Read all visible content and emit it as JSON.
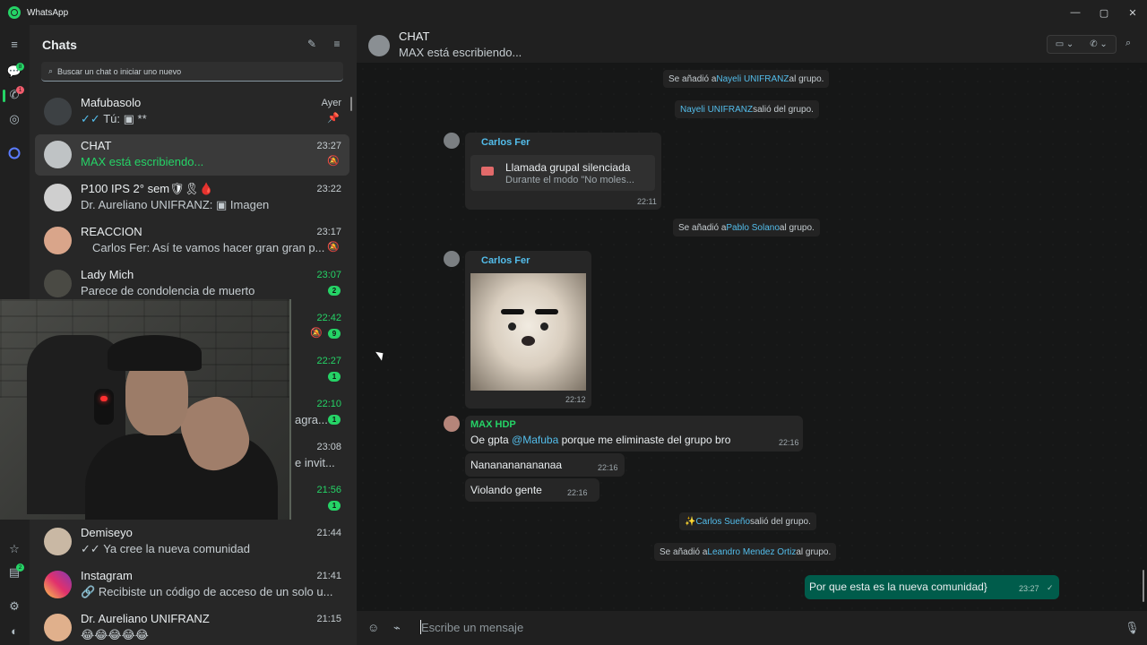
{
  "app": {
    "title": "WhatsApp"
  },
  "window": {
    "minimize": "—",
    "maximize": "▢",
    "close": "✕"
  },
  "rail": {
    "chats_badge": "8",
    "calls_badge": "1",
    "archive_badge": "2"
  },
  "sidebar": {
    "title": "Chats",
    "search_placeholder": "Buscar un chat o iniciar uno nuevo",
    "chats": [
      {
        "name": "Mafubasolo",
        "time": "Ayer",
        "preview_prefix": "Tú:",
        "preview": "**",
        "ticks": "✓✓",
        "trailing": "pin-icon"
      },
      {
        "name": "CHAT",
        "time": "23:27",
        "preview": "MAX está escribiendo...",
        "trailing": "muted-icon"
      },
      {
        "name": "P100 IPS 2° sem",
        "time": "23:22",
        "preview": "Dr. Aureliano UNIFRANZ:",
        "preview_suffix": "Imagen"
      },
      {
        "name": "REACCION",
        "time": "23:17",
        "preview": "Carlos Fer: Así te vamos hacer gran gran p...",
        "trailing": "muted-icon"
      },
      {
        "name": "Lady Mich",
        "time": "23:07",
        "preview": "Parece de condolencia de muerto",
        "unread": "2"
      },
      {
        "time": "22:42",
        "unread": "9"
      },
      {
        "time": "22:27",
        "unread": "1"
      },
      {
        "time": "22:10",
        "preview_partial": "agra...",
        "unread": "1"
      },
      {
        "time": "23:08",
        "preview_partial": "e invit..."
      },
      {
        "time": "21:56",
        "unread": "1"
      },
      {
        "name": "Demiseyo",
        "time": "21:44",
        "preview": "Ya cree la nueva comunidad",
        "ticks": "✓✓"
      },
      {
        "name": "Instagram",
        "time": "21:41",
        "preview": "Recibiste un código de acceso de un solo u..."
      },
      {
        "name": "Dr. Aureliano UNIFRANZ",
        "time": "21:15",
        "preview": "😂😂😂😂😂"
      }
    ]
  },
  "chat": {
    "title": "CHAT",
    "subtitle": "MAX está escribiendo...",
    "composer_placeholder": "Escribe un mensaje",
    "sys1": {
      "pre": "Se añadió a ",
      "name": "Nayeli UNIFRANZ",
      "post": " al grupo."
    },
    "sys2": {
      "name": "Nayeli UNIFRANZ",
      "post": " salió del grupo."
    },
    "msg1": {
      "sender": "Carlos Fer",
      "call_title": "Llamada grupal silenciada",
      "call_sub": "Durante el modo \"No moles...",
      "time": "22:11"
    },
    "sys3": {
      "pre": "Se añadió a ",
      "name": "Pablo Solano",
      "post": " al grupo."
    },
    "msg2": {
      "sender": "Carlos Fer",
      "time": "22:12"
    },
    "msg3": {
      "sender": "MAX HDP",
      "text_pre": "Oe gpta ",
      "mention": "@Mafuba",
      "text_post": " porque me eliminaste del grupo bro",
      "time": "22:16"
    },
    "msg4": {
      "text": "Nananananananaa",
      "time": "22:16"
    },
    "msg5": {
      "text": "Violando gente",
      "time": "22:16"
    },
    "sys4": {
      "name": "✨Carlos Sueño",
      "post": " salió del grupo."
    },
    "sys5": {
      "pre": "Se añadió a ",
      "name": "Leandro Mendez Ortiz",
      "post": " al grupo."
    },
    "out1": {
      "text": "Por que esta es la nueva comunidad}",
      "time": "23:27",
      "tick": "✓"
    }
  },
  "colors": {
    "accent": "#25d366",
    "mention": "#53bdeb",
    "outgoing": "#005c4b",
    "sender_green": "#25d366",
    "sender_blue": "#53bdeb"
  }
}
